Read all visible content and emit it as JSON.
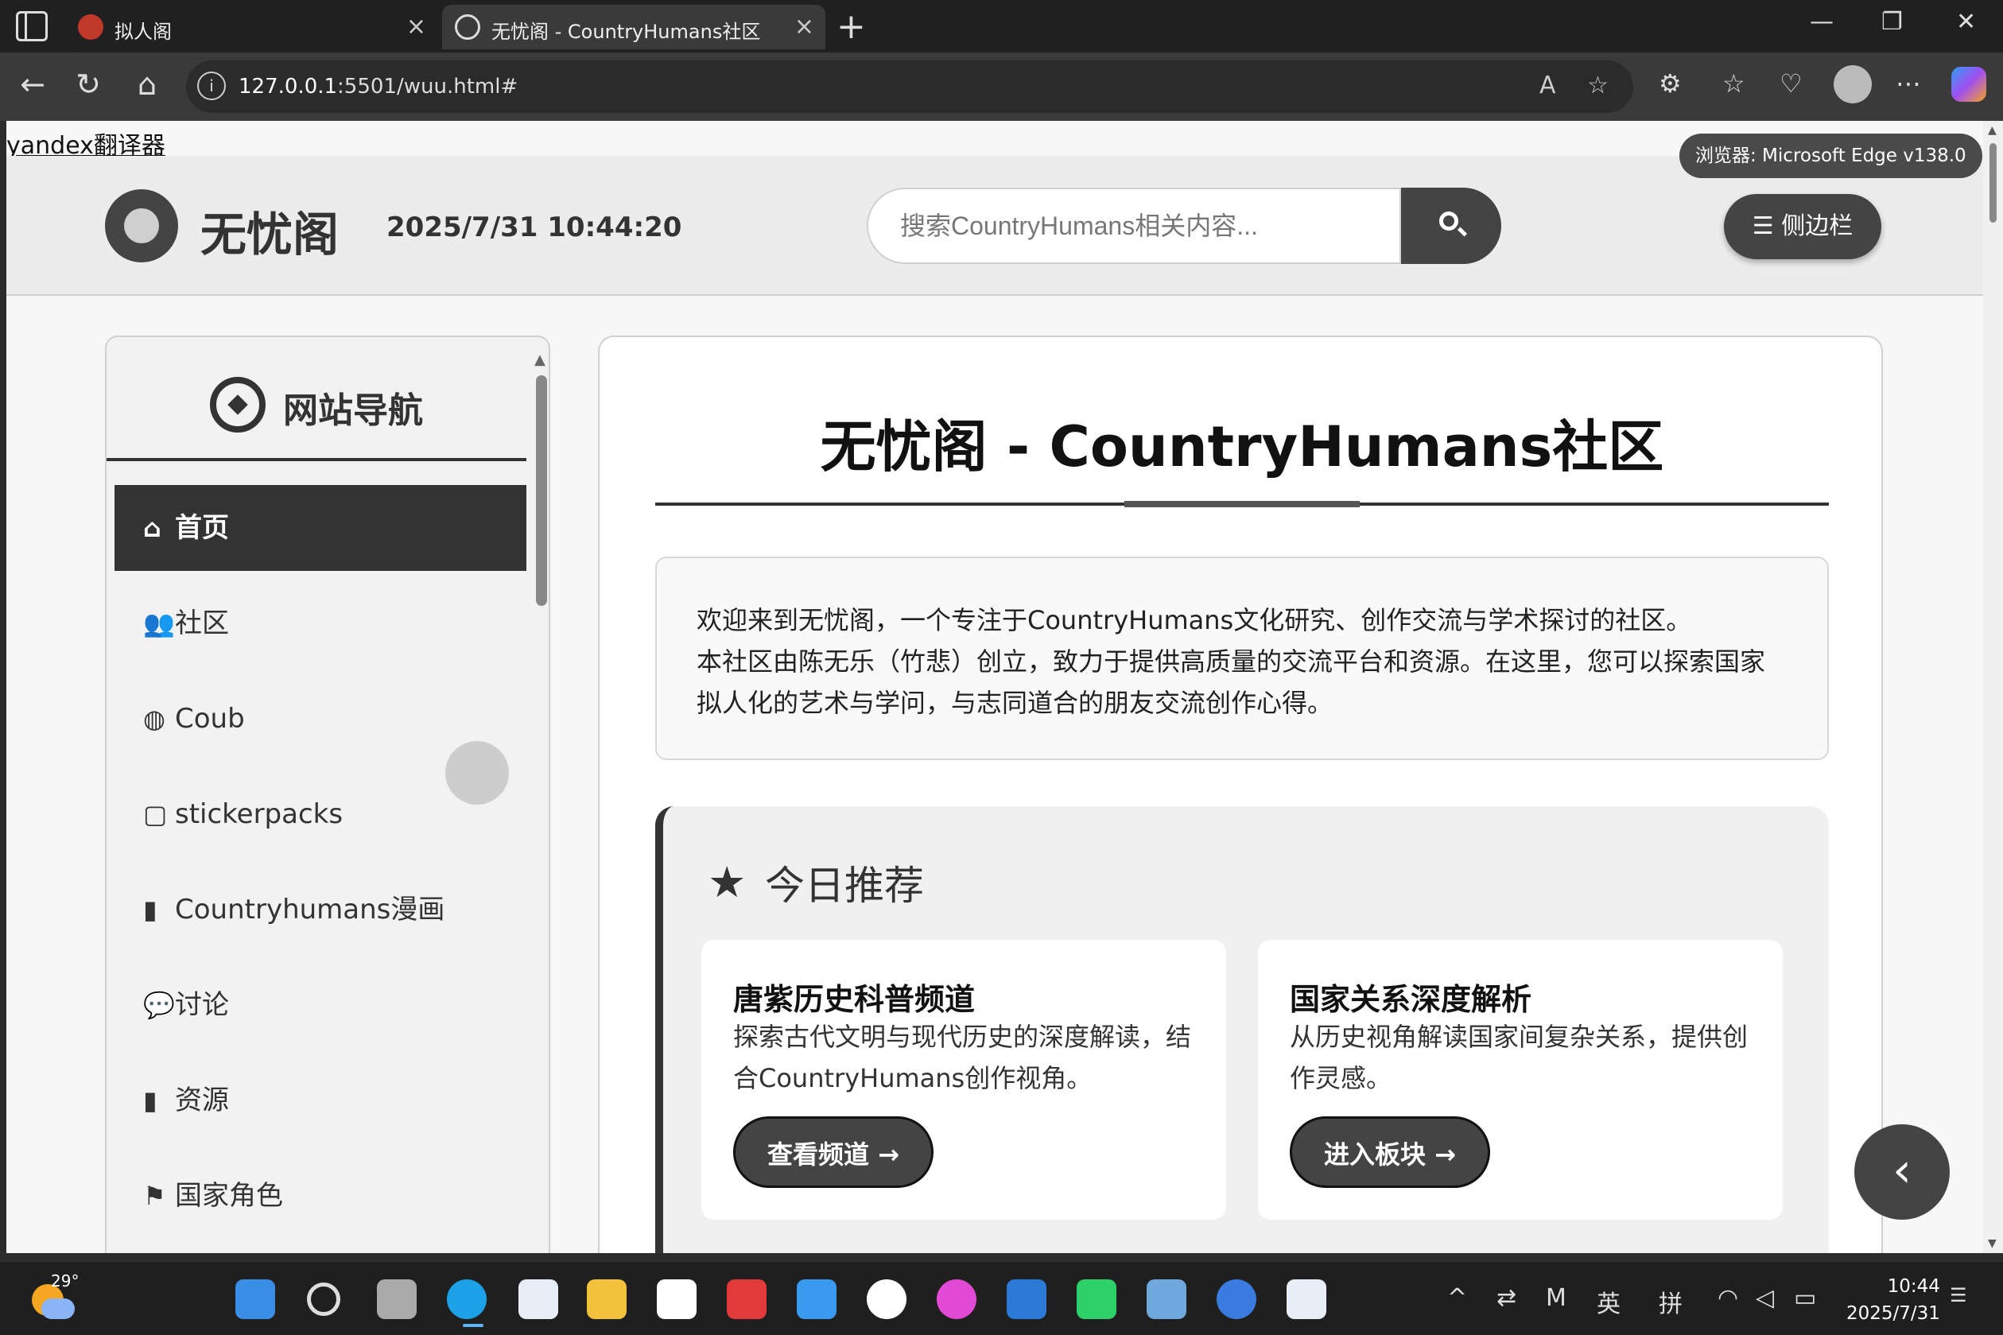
{
  "browser": {
    "tabs": [
      {
        "title": "拟人阁"
      },
      {
        "title": "无忧阁 - CountryHumans社区"
      }
    ],
    "url_host": "127.0.0.1",
    "url_rest": ":5501/wuu.html#"
  },
  "page": {
    "yandex_link": "yandex翻译器",
    "browser_tip": "浏览器: Microsoft Edge v138.0",
    "logo_name": "无忧阁",
    "datetime": "2025/7/31 10:44:20",
    "search_placeholder": "搜索CountryHumans相关内容...",
    "sidebar_button": "侧边栏"
  },
  "sidebar": {
    "title": "网站导航",
    "items": [
      {
        "label": "首页",
        "icon": "home-icon"
      },
      {
        "label": "社区",
        "icon": "users-icon"
      },
      {
        "label": "Coub",
        "icon": "globe-icon"
      },
      {
        "label": "stickerpacks",
        "icon": "sticky-note-icon"
      },
      {
        "label": "Countryhumans漫画",
        "icon": "book-icon"
      },
      {
        "label": "讨论",
        "icon": "comments-icon"
      },
      {
        "label": "资源",
        "icon": "book-icon"
      },
      {
        "label": "国家角色",
        "icon": "flag-icon"
      }
    ]
  },
  "main": {
    "title": "无忧阁 - CountryHumans社区",
    "intro_line1": "欢迎来到无忧阁，一个专注于CountryHumans文化研究、创作交流与学术探讨的社区。",
    "intro_line2": "本社区由陈无乐（竹悲）创立，致力于提供高质量的交流平台和资源。在这里，您可以探索国家拟人化的艺术与学问，与志同道合的朋友交流创作心得。",
    "recommend_title": "今日推荐",
    "cards": [
      {
        "title": "唐紫历史科普频道",
        "desc": "探索古代文明与现代历史的深度解读，结合CountryHumans创作视角。",
        "button": "查看频道 →"
      },
      {
        "title": "国家关系深度解析",
        "desc": "从历史视角解读国家间复杂关系，提供创作灵感。",
        "button": "进入板块 →"
      }
    ]
  },
  "taskbar": {
    "temperature": "29°",
    "tray_lang1": "英",
    "tray_lang2": "拼",
    "time": "10:44",
    "date": "2025/7/31"
  }
}
